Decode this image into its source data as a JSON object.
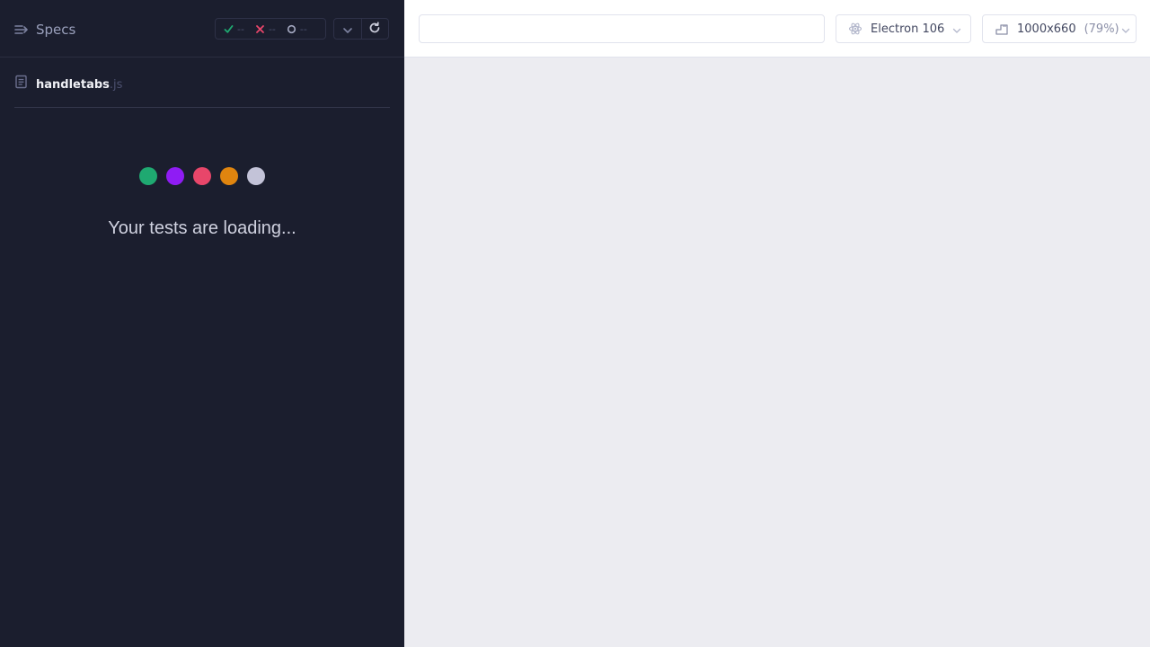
{
  "reporter": {
    "specs_label": "Specs",
    "stats": {
      "passed": "--",
      "failed": "--",
      "pending": "--"
    },
    "spec_file": {
      "name": "handletabs",
      "ext": ".js"
    },
    "loading_text": "Your tests are loading...",
    "loader_colors": [
      "#1fa971",
      "#8f1cf4",
      "#e8466a",
      "#e0850f",
      "#c3c3d8"
    ]
  },
  "aut": {
    "url_value": "",
    "browser_label": "Electron 106",
    "viewport_label": "1000x660",
    "zoom_label": "(79%)"
  }
}
